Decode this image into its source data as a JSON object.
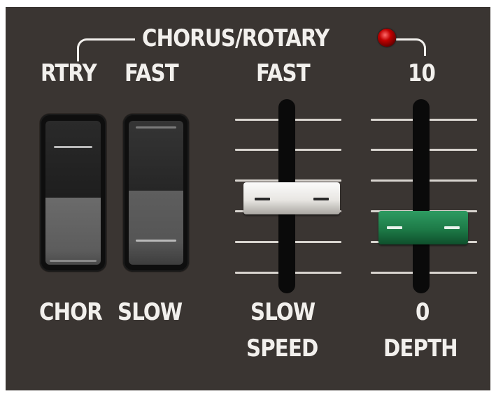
{
  "header": {
    "title": "CHORUS/ROTARY"
  },
  "switch_labels": {
    "top_left": "RTRY",
    "top_right": "FAST",
    "bottom_left": "CHOR",
    "bottom_right": "SLOW"
  },
  "speed_fader": {
    "top_label": "FAST",
    "bottom_label": "SLOW",
    "name": "SPEED",
    "position": 0.52
  },
  "depth_fader": {
    "top_label": "10",
    "bottom_label": "0",
    "name": "DEPTH",
    "position": 0.27
  },
  "indicator": {
    "color": "#c00000",
    "state": "on"
  },
  "colors": {
    "panel": "#3a3532",
    "text": "#f2f0ed",
    "speed_cap": "#ebe9e6",
    "depth_cap": "#1d7a47",
    "led": "#c00000"
  }
}
